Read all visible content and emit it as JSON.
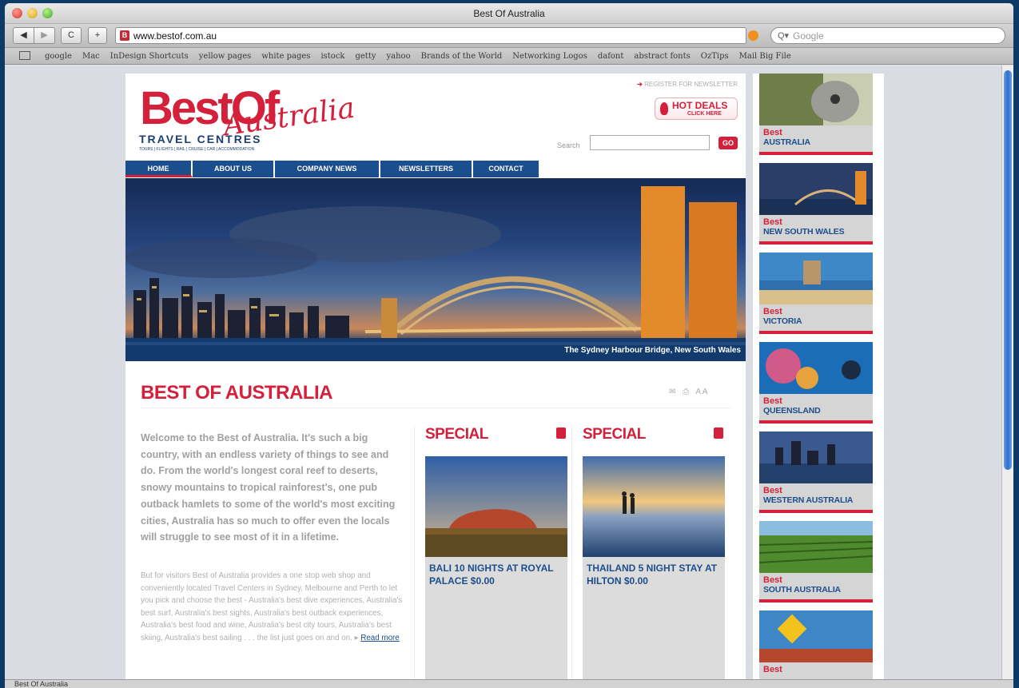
{
  "window": {
    "title": "Best Of Australia",
    "status_text": "Best Of Australia"
  },
  "toolbar": {
    "back_label": "◀",
    "forward_label": "▶",
    "reload_label": "C",
    "add_label": "+",
    "url": "www.bestof.com.au",
    "search_placeholder": "Google"
  },
  "bookmarks": [
    "google",
    "Mac",
    "InDesign Shortcuts",
    "yellow pages",
    "white pages",
    "istock",
    "getty",
    "yahoo",
    "Brands of the World",
    "Networking Logos",
    "dafont",
    "abstract fonts",
    "OzTips",
    "Mail Big File"
  ],
  "site": {
    "logo_best": "BestOf",
    "logo_australia": "Australia",
    "logo_travel": "TRAVEL CENTRES",
    "logo_sub": "TOURS | FLIGHTS | RAIL | CRUISE | CAR | ACCOMMODATION",
    "register": "REGISTER FOR NEWSLETTER",
    "hot_deals": "HOT DEALS",
    "hot_deals_sub": "CLICK HERE",
    "search_label": "Search",
    "go_label": "GO",
    "nav": [
      "HOME",
      "ABOUT US",
      "COMPANY NEWS",
      "NEWSLETTERS",
      "CONTACT"
    ],
    "hero_caption": "The Sydney Harbour Bridge, New South Wales",
    "page_title": "BEST OF AUSTRALIA",
    "text_size_label": "A A",
    "welcome": "Welcome to the Best of Australia. It's such a big country, with an endless variety of things to see and do. From the world's longest coral reef to deserts, snowy mountains to tropical rainforest's, one pub outback hamlets to some of the world's most exciting cities, Australia has so much to offer even the locals will struggle to see most of it in a lifetime.",
    "body2": "But for visitors Best of Australia provides a one stop web shop and conveniently located Travel Centers in Sydney, Melbourne and Perth to let you pick and choose the best - Australia's best dive experiences, Australia's best surf, Australia's best sights, Australia's best outback experiences, Australia's best food and wine, Australia's best city tours, Australia's best skiing, Australia's best sailing . . . the list just goes on and on.",
    "read_more": "Read more",
    "specials": [
      {
        "heading": "SPECIAL",
        "caption": "BALI 10 NIGHTS AT ROYAL PALACE $0.00"
      },
      {
        "heading": "SPECIAL",
        "caption": "THAILAND 5 NIGHT STAY AT HILTON $0.00"
      }
    ],
    "regions": [
      {
        "best": "Best",
        "name": "AUSTRALIA"
      },
      {
        "best": "Best",
        "name": "NEW SOUTH WALES"
      },
      {
        "best": "Best",
        "name": "VICTORIA"
      },
      {
        "best": "Best",
        "name": "QUEENSLAND"
      },
      {
        "best": "Best",
        "name": "WESTERN AUSTRALIA"
      },
      {
        "best": "Best",
        "name": "SOUTH AUSTRALIA"
      },
      {
        "best": "Best",
        "name": ""
      }
    ]
  },
  "colors": {
    "brand_red": "#d4203a",
    "brand_blue": "#1b4e8c"
  }
}
